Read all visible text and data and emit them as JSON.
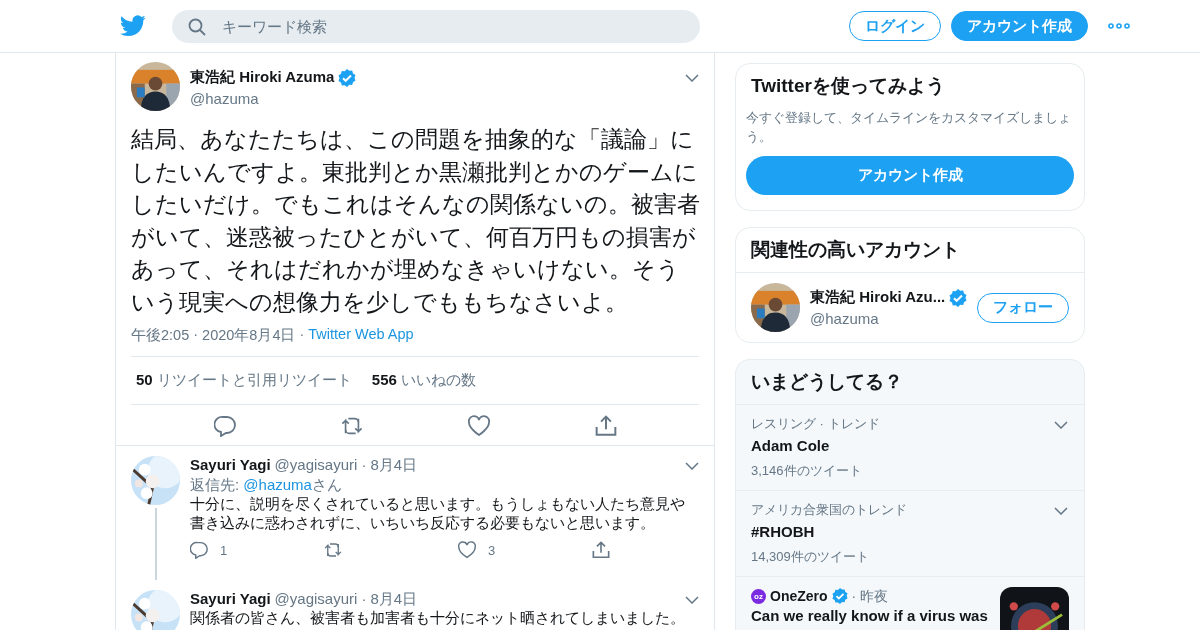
{
  "header": {
    "search": {
      "placeholder": "キーワード検索"
    },
    "login": "ログイン",
    "signup": "アカウント作成"
  },
  "tweet": {
    "name": "東浩紀 Hiroki Azuma",
    "verified": true,
    "handle": "@hazuma",
    "text": "結局、あなたたちは、この問題を抽象的な「議論」にしたいんですよ。東批判とか黒瀬批判とかのゲームにしたいだけ。でもこれはそんなの関係ないの。被害者がいて、迷惑被ったひとがいて、何百万円もの損害があって、それはだれかが埋めなきゃいけない。そういう現実への想像力を少しでももちなさいよ。",
    "time": "午後2:05",
    "separator": "·",
    "date": "2020年8月4日",
    "source": "Twitter Web App",
    "stats": [
      {
        "count": "50",
        "label": "リツイートと引用リツイート"
      },
      {
        "count": "556",
        "label": "いいねの数"
      }
    ]
  },
  "replies": [
    {
      "name": "Sayuri Yagi",
      "handle": "@yagisayuri",
      "separator": "·",
      "date": "8月4日",
      "reply_to_label": "返信先:",
      "reply_to": "@hazuma",
      "reply_to_suffix": "さん",
      "text": "十分に、説明を尽くされていると思います。もうしょもない人たち意見や書き込みに惑わされずに、いちいち反応する必要もないと思います。",
      "replies": "1",
      "likes": "3",
      "thread": true
    },
    {
      "name": "Sayuri Yagi",
      "handle": "@yagisayuri",
      "separator": "·",
      "date": "8月4日",
      "text": "関係者の皆さん、被害者も加害者も十分にネット晒されてしまいました。",
      "thread": false
    }
  ],
  "signup_card": {
    "title": "Twitterを使ってみよう",
    "text": "今すぐ登録して、タイムラインをカスタマイズしましょう。",
    "button": "アカウント作成"
  },
  "related": {
    "title": "関連性の高いアカウント",
    "accounts": [
      {
        "name": "東浩紀 Hiroki Azu...",
        "verified": true,
        "handle": "@hazuma",
        "button": "フォロー"
      }
    ]
  },
  "trends": {
    "title": "いまどうしてる？",
    "items": [
      {
        "kind": "trend",
        "category": "レスリング · トレンド",
        "name": "Adam Cole",
        "count": "3,146件のツイート"
      },
      {
        "kind": "trend",
        "category": "アメリカ合衆国のトレンド",
        "name": "#RHOBH",
        "count": "14,309件のツイート"
      },
      {
        "kind": "news",
        "logo": "oz",
        "source": "OneZero",
        "verified": true,
        "separator": "·",
        "time": "昨夜",
        "text": "Can we really know if a virus was"
      }
    ]
  }
}
